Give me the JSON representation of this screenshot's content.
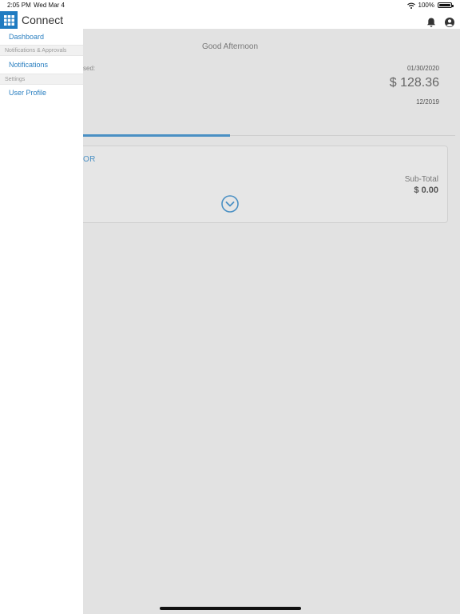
{
  "status_bar": {
    "time": "2:05 PM",
    "date": "Wed Mar 4",
    "battery": "100%"
  },
  "header": {
    "title": "Connect",
    "icons": [
      "apps-grid-icon",
      "bell-icon",
      "user-profile-icon"
    ],
    "accent_color": "#1f7bc1"
  },
  "main": {
    "greeting": "Good Afternoon",
    "summary_label_partial": "sed:",
    "date": "01/30/2020",
    "amount": "$ 128.36",
    "period": "12/2019",
    "card": {
      "title_partial": "OR",
      "subtotal_label": "Sub-Total",
      "subtotal_value": "$ 0.00",
      "expand_icon": "chevron-down-circle-icon"
    }
  },
  "sidebar": {
    "items": [
      {
        "type": "link",
        "label": "Dashboard"
      },
      {
        "type": "section",
        "label": "Notifications & Approvals"
      },
      {
        "type": "link",
        "label": "Notifications"
      },
      {
        "type": "section",
        "label": "Settings"
      },
      {
        "type": "link",
        "label": "User Profile"
      }
    ]
  }
}
